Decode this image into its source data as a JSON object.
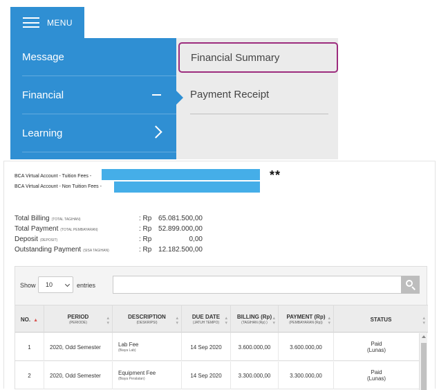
{
  "menu": {
    "label": "MENU"
  },
  "nav": {
    "items": [
      {
        "label": "Message"
      },
      {
        "label": "Financial"
      },
      {
        "label": "Learning"
      }
    ],
    "submenu": [
      {
        "label": "Financial Summary"
      },
      {
        "label": "Payment Receipt"
      }
    ]
  },
  "accounts": {
    "tuition_label": "BCA Virtual Account - Tuition Fees -",
    "non_tuition_label": "BCA Virtual Account - Non Tuition Fees -",
    "note_marker": "**"
  },
  "summary": [
    {
      "label": "Total Billing",
      "sub": "(TOTAL TAGIHAN)",
      "currency": ": Rp",
      "value": "65.081.500,00"
    },
    {
      "label": "Total Payment",
      "sub": "(TOTAL PEMBAYARAN)",
      "currency": ": Rp",
      "value": "52.899.000,00"
    },
    {
      "label": "Deposit",
      "sub": "(DEPOSIT)",
      "currency": ": Rp",
      "value": "0,00"
    },
    {
      "label": "Outstanding Payment",
      "sub": "(SISA TAGIHAN)",
      "currency": ": Rp",
      "value": "12.182.500,00"
    }
  ],
  "table_controls": {
    "show_label": "Show",
    "page_size": "10",
    "entries_label": "entries"
  },
  "table": {
    "headers": [
      {
        "main": "NO.",
        "sub": ""
      },
      {
        "main": "PERIOD",
        "sub": "(PERIODE)"
      },
      {
        "main": "DESCRIPTION",
        "sub": "(DESKRIPSI)"
      },
      {
        "main": "DUE DATE",
        "sub": "(JATUH TEMPO)"
      },
      {
        "main": "BILLING (Rp)",
        "sub": "(TAGIHAN (Rp) )"
      },
      {
        "main": "PAYMENT (Rp)",
        "sub": "(PEMBAYARAN (Rp))"
      },
      {
        "main": "STATUS",
        "sub": ""
      }
    ],
    "rows": [
      {
        "no": "1",
        "period": "2020, Odd Semester",
        "desc": "Lab Fee",
        "desc_sub": "(Biaya Lab)",
        "due": "14 Sep 2020",
        "billing": "3.600.000,00",
        "payment": "3.600.000,00",
        "status": "Paid",
        "status_sub": "(Lunas)"
      },
      {
        "no": "2",
        "period": "2020, Odd Semester",
        "desc": "Equipment Fee",
        "desc_sub": "(Biaya Peralatan)",
        "due": "14 Sep 2020",
        "billing": "3.300.000,00",
        "payment": "3.300.000,00",
        "status": "Paid",
        "status_sub": "(Lunas)"
      }
    ]
  },
  "colors": {
    "nav_blue": "#2f8fd3",
    "submenu_bg": "#ebebeb",
    "highlight_border": "#9c2b7d",
    "redaction_bar": "#45aee8"
  }
}
